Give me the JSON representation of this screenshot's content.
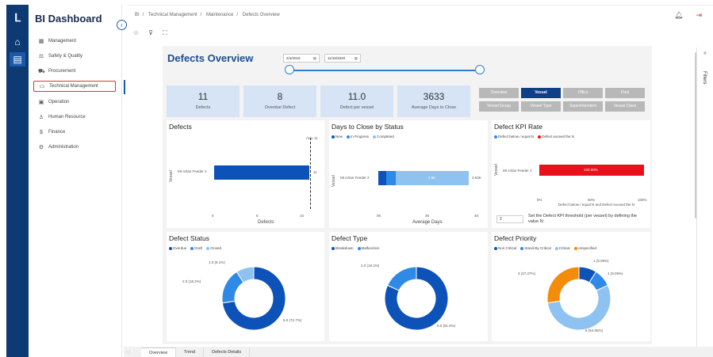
{
  "app": {
    "title": "BI Dashboard"
  },
  "nav": {
    "items": [
      {
        "label": "Management",
        "icon": "grid-icon"
      },
      {
        "label": "Safety & Quality",
        "icon": "scale-icon"
      },
      {
        "label": "Procurement",
        "icon": "cart-icon"
      },
      {
        "label": "Technical Management",
        "icon": "monitor-icon"
      },
      {
        "label": "Operation",
        "icon": "calendar-icon"
      },
      {
        "label": "Human Resource",
        "icon": "person-icon"
      },
      {
        "label": "Finance",
        "icon": "dollar-icon"
      },
      {
        "label": "Administration",
        "icon": "admin-icon"
      }
    ],
    "highlighted": "Technical Management"
  },
  "breadcrumb": [
    "BI",
    "Technical Management",
    "Maintenance",
    "Defects Overview"
  ],
  "report": {
    "title": "Defects Overview",
    "date_from": "2/4/2019",
    "date_to": "11/16/2020",
    "kpis": [
      {
        "value": "11",
        "label": "Defects"
      },
      {
        "value": "8",
        "label": "Overdue Defect"
      },
      {
        "value": "11.0",
        "label": "Defect per vessel"
      },
      {
        "value": "3633",
        "label": "Average Days to Close"
      }
    ],
    "view_buttons_row1": [
      "Overview",
      "Vessel",
      "Office",
      "Pool"
    ],
    "view_buttons_row2": [
      "Vessel Group",
      "Vessel Type",
      "Superintendent",
      "Vessel Class"
    ],
    "active_view": "Vessel"
  },
  "cards": {
    "defects": {
      "title": "Defects",
      "ylabel": "Vessel",
      "xlabel": "Defects",
      "category": "Mt Azlan Feeder 2",
      "value": 11,
      "value_label": "11",
      "avg_label": "Avg: 11",
      "ticks": [
        "0",
        "5",
        "10"
      ]
    },
    "days_to_close": {
      "title": "Days to Close by Status",
      "legend": [
        "New",
        "In Progress",
        "Completed"
      ],
      "ylabel": "Vessel",
      "xlabel": "Average Days",
      "category": "Mt Azlan Feeder 2",
      "inside_label": "2.9K",
      "end_label": "3.63K",
      "ticks": [
        "0K",
        "2K",
        "4K"
      ]
    },
    "defect_kpi": {
      "title": "Defect KPI Rate",
      "legend": [
        "Defect below / equal N",
        "Defect exceed the N"
      ],
      "ylabel": "Vessel",
      "category": "Mt Azlan Feeder 2",
      "bar_label": "100.00%",
      "ticks": [
        "0%",
        "50%",
        "100%"
      ],
      "axis_title": "Defect below / equal N and Defect exceed the N",
      "threshold_value": "2",
      "threshold_text": "Set the Defect KPI threshold (per vessel) by defining the value N:"
    },
    "defect_status": {
      "title": "Defect Status",
      "legend": [
        "Overdue",
        "Draft",
        "Closed"
      ],
      "labels": [
        "1.0 (9.1%)",
        "2.0 (18.2%)",
        "8.0 (72.7%)"
      ]
    },
    "defect_type": {
      "title": "Defect Type",
      "legend": [
        "Breakdown",
        "Malfunction"
      ],
      "labels": [
        "2.0 (18.2%)",
        "9.0 (81.8%)"
      ]
    },
    "defect_priority": {
      "title": "Defect Priority",
      "legend": [
        "Non Critical",
        "Stand-By Critical",
        "Critical",
        "Unspecified"
      ],
      "labels": [
        "1 (9.09%)",
        "1 (9.09%)",
        "3 (27.27%)",
        "6 (54.55%)"
      ]
    }
  },
  "chart_data": [
    {
      "type": "bar",
      "title": "Defects",
      "ylabel": "Vessel",
      "xlabel": "Defects",
      "categories": [
        "Mt Azlan Feeder 2"
      ],
      "values": [
        11
      ],
      "xlim": [
        0,
        11
      ]
    },
    {
      "type": "bar",
      "title": "Days to Close by Status",
      "ylabel": "Vessel",
      "xlabel": "Average Days",
      "categories": [
        "Mt Azlan Feeder 2"
      ],
      "series": [
        {
          "name": "New",
          "values": [
            300
          ]
        },
        {
          "name": "In Progress",
          "values": [
            430
          ]
        },
        {
          "name": "Completed",
          "values": [
            2900
          ]
        }
      ],
      "xlim": [
        0,
        4000
      ]
    },
    {
      "type": "bar",
      "title": "Defect KPI Rate",
      "ylabel": "Vessel",
      "categories": [
        "Mt Azlan Feeder 2"
      ],
      "series": [
        {
          "name": "Defect exceed the N",
          "values": [
            100
          ]
        }
      ],
      "xlim": [
        0,
        100
      ]
    },
    {
      "type": "pie",
      "title": "Defect Status",
      "categories": [
        "Overdue",
        "Draft",
        "Closed"
      ],
      "values": [
        8,
        2,
        1
      ]
    },
    {
      "type": "pie",
      "title": "Defect Type",
      "categories": [
        "Breakdown",
        "Malfunction"
      ],
      "values": [
        9,
        2
      ]
    },
    {
      "type": "pie",
      "title": "Defect Priority",
      "categories": [
        "Non Critical",
        "Stand-By Critical",
        "Critical",
        "Unspecified"
      ],
      "values": [
        1,
        1,
        6,
        3
      ]
    }
  ],
  "colors": {
    "dark_blue": "#0d52b8",
    "mid_blue": "#2e8ae6",
    "light_blue": "#8ec2f0",
    "orange": "#f28c0a",
    "red": "#e8101a"
  },
  "filters_label": "Filters",
  "bottom_tabs": [
    "Overview",
    "Trend",
    "Defects Details"
  ]
}
